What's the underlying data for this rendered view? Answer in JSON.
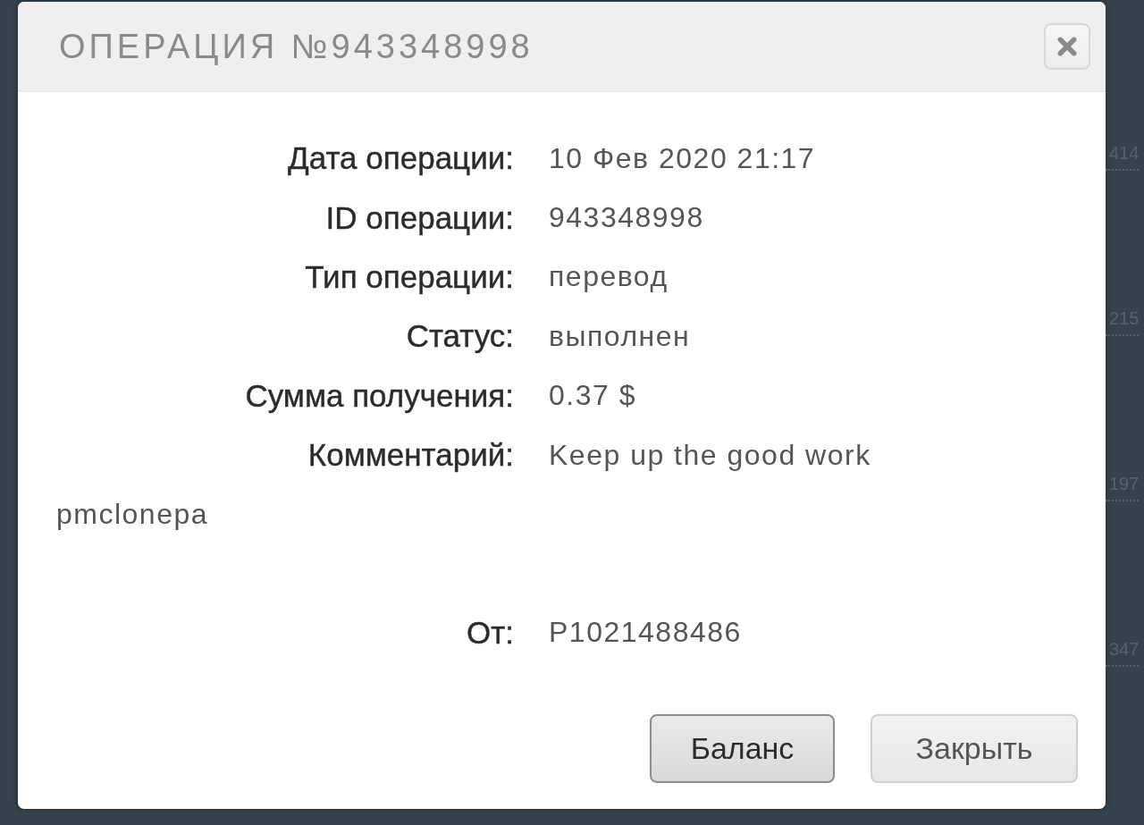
{
  "background": {
    "side_values": [
      "414",
      "215",
      "197",
      "347"
    ]
  },
  "dialog": {
    "title": "ОПЕРАЦИЯ №943348998",
    "fields": [
      {
        "label": "Дата операции:",
        "value": "10 Фев 2020 21:17"
      },
      {
        "label": "ID операции:",
        "value": "943348998"
      },
      {
        "label": "Тип операции:",
        "value": "перевод"
      },
      {
        "label": "Статус:",
        "value": "выполнен"
      },
      {
        "label": "Сумма получения:",
        "value": "0.37 $"
      },
      {
        "label": "Комментарий:",
        "value": "Keep up the good work"
      }
    ],
    "note": "pmclonepa",
    "sender": {
      "label": "От:",
      "value": "P1021488486"
    },
    "buttons": [
      {
        "label": "Баланс",
        "focused": true
      },
      {
        "label": "Закрыть",
        "focused": false
      }
    ]
  }
}
